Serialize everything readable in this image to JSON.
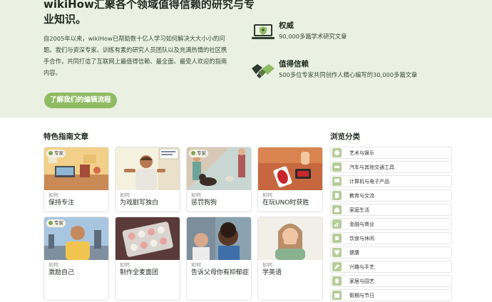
{
  "hero": {
    "title": "wikiHow汇聚各个领域值得信赖的研究与专业知识。",
    "description": "自2005年以来，wikiHow已帮助数十亿人学习如何解决大大小小的问题。我们与资深专家、训练有素的研究人员团队以及充满热情的社区携手合作，共同打造了互联网上最值得信赖、最全面、最受人欢迎的指南内容。",
    "button_label": "了解我们的编辑流程",
    "features": [
      {
        "icon": "laptop-shield-icon",
        "title": "权威",
        "description": "90,000多篇学术研究文章"
      },
      {
        "icon": "handshake-icon",
        "title": "值得信赖",
        "description": "500多位专家共同创作人精心编写的30,000多篇文章"
      }
    ]
  },
  "featured": {
    "title": "特色指南文章",
    "how_prefix": "如何",
    "expert_badge": "专家",
    "articles": [
      {
        "title": "保持专注",
        "expert": true,
        "icon": "desk-study-illustration"
      },
      {
        "title": "为戏剧写独白",
        "expert": false,
        "icon": "man-speaking-illustration"
      },
      {
        "title": "惩罚狗狗",
        "expert": true,
        "icon": "dog-training-illustration"
      },
      {
        "title": "在玩UNO时获胜",
        "expert": false,
        "icon": "uno-cards-illustration"
      },
      {
        "title": "激励自己",
        "expert": true,
        "icon": "motivation-illustration"
      },
      {
        "title": "制作全麦面团",
        "expert": false,
        "icon": "dough-balls-illustration"
      },
      {
        "title": "告诉父母你有抑郁症",
        "expert": false,
        "icon": "family-talk-illustration"
      },
      {
        "title": "学英语",
        "expert": false,
        "icon": "woman-laughing-illustration"
      }
    ]
  },
  "browse": {
    "title": "浏览分类",
    "categories": [
      {
        "label": "艺术与娱乐",
        "icon": "palette-icon"
      },
      {
        "label": "汽车与其他交通工具",
        "icon": "car-icon"
      },
      {
        "label": "计算机与电子产品",
        "icon": "monitor-icon"
      },
      {
        "label": "教育与交流",
        "icon": "book-icon"
      },
      {
        "label": "家庭生活",
        "icon": "house-icon"
      },
      {
        "label": "金融与商业",
        "icon": "chart-icon"
      },
      {
        "label": "饮食与休闲",
        "icon": "cup-icon"
      },
      {
        "label": "健康",
        "icon": "heart-icon"
      },
      {
        "label": "兴趣与手艺",
        "icon": "pencil-icon"
      },
      {
        "label": "家居与园艺",
        "icon": "leaf-icon"
      },
      {
        "label": "假期与节日",
        "icon": "calendar-icon"
      }
    ]
  },
  "colors": {
    "hero_bg": "#eaf0e2",
    "accent": "#8fbb63",
    "icon_bg": "#b7cc99"
  }
}
